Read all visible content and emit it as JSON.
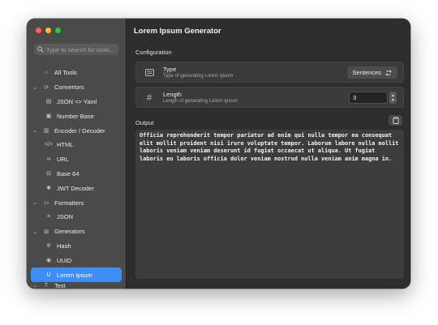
{
  "window": {
    "traffic_lights": [
      "close",
      "minimize",
      "zoom"
    ]
  },
  "sidebar": {
    "search_placeholder": "Type to search for tools...",
    "items": [
      {
        "kind": "top",
        "label": "All Tools",
        "icon": "home-icon",
        "glyph": "⌂"
      },
      {
        "kind": "group",
        "label": "Convertors",
        "icon": "arrows-cycle-icon",
        "glyph": "⟳"
      },
      {
        "kind": "child",
        "label": "JSON <> Yaml",
        "icon": "doc-icon",
        "glyph": "▤"
      },
      {
        "kind": "child",
        "label": "Number Base",
        "icon": "number-box-icon",
        "glyph": "▣"
      },
      {
        "kind": "group",
        "label": "Encoder / Decoder",
        "icon": "encoder-box-icon",
        "glyph": "▥"
      },
      {
        "kind": "child",
        "label": "HTML",
        "icon": "code-brackets-icon",
        "glyph": "</>"
      },
      {
        "kind": "child",
        "label": "URL",
        "icon": "link-icon",
        "glyph": "∞"
      },
      {
        "kind": "child",
        "label": "Base 64",
        "icon": "base64-icon",
        "glyph": "⊟"
      },
      {
        "kind": "child",
        "label": "JWT Decoder",
        "icon": "jwt-sparkle-icon",
        "glyph": "✺"
      },
      {
        "kind": "group",
        "label": "Formatters",
        "icon": "formatter-box-icon",
        "glyph": "▭"
      },
      {
        "kind": "child",
        "label": "JSON",
        "icon": "lines-icon",
        "glyph": "≡"
      },
      {
        "kind": "group",
        "label": "Generators",
        "icon": "generator-box-icon",
        "glyph": "⊞"
      },
      {
        "kind": "child",
        "label": "Hash",
        "icon": "hash-gear-icon",
        "glyph": "✲"
      },
      {
        "kind": "child",
        "label": "UUID",
        "icon": "uuid-circle-icon",
        "glyph": "◉"
      },
      {
        "kind": "selected",
        "label": "Lorem Ipsum",
        "icon": "lorem-ipsum-icon",
        "glyph": "U"
      },
      {
        "kind": "group-cut",
        "label": "Text",
        "icon": "text-icon",
        "glyph": "T"
      }
    ]
  },
  "main": {
    "title": "Lorem Ipsum Generator",
    "configuration_label": "Configuration",
    "type": {
      "title": "Type",
      "subtitle": "Type of generating Lorem Ipsum",
      "value": "Sentences"
    },
    "length": {
      "title": "Length",
      "subtitle": "Length of generating Lorem Ipsum",
      "value": "3"
    },
    "output_label": "Output",
    "output_text": "Officia reprehenderit tempor pariatur ad enim qui nulla tempor ea consequat elit mollit proident nisi irure voluptate tempor. Laborum labore nulla mollit laboris veniam veniam deserunt id fugiat occaecat ut aliqua. Ut fugiat laboris eu laboris officia dolor veniam nostrud nulla veniam anim magna in."
  },
  "colors": {
    "accent": "#3d8ff7",
    "close": "#ff5f57",
    "minimize": "#febc2e",
    "zoom": "#28c840"
  }
}
